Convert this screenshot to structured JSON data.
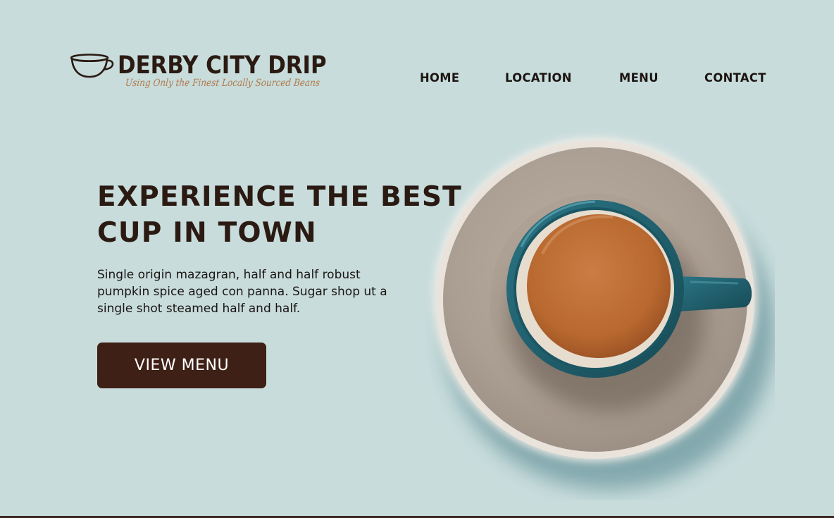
{
  "header": {
    "brand_name": "DERBY CITY DRIP",
    "tagline": "Using Only the Finest Locally Sourced Beans",
    "logo_icon": "coffee-cup-icon"
  },
  "nav": {
    "items": [
      {
        "label": "HOME"
      },
      {
        "label": "LOCATION"
      },
      {
        "label": "MENU"
      },
      {
        "label": "CONTACT"
      }
    ]
  },
  "hero": {
    "title_line_1": "EXPERIENCE THE BEST",
    "title_line_2": "CUP IN TOWN",
    "body": "Single origin mazagran, half and half robust pumpkin spice aged con panna. Sugar shop ut a single shot steamed half and half.",
    "cta_label": "VIEW MENU"
  },
  "colors": {
    "background": "#c8dcdc",
    "text_dark": "#2a1a12",
    "tagline": "#b07a4a",
    "button": "#3e2016",
    "mug": "#1f5a66",
    "coffee": "#c0703a",
    "saucer": "#b3a79c"
  }
}
